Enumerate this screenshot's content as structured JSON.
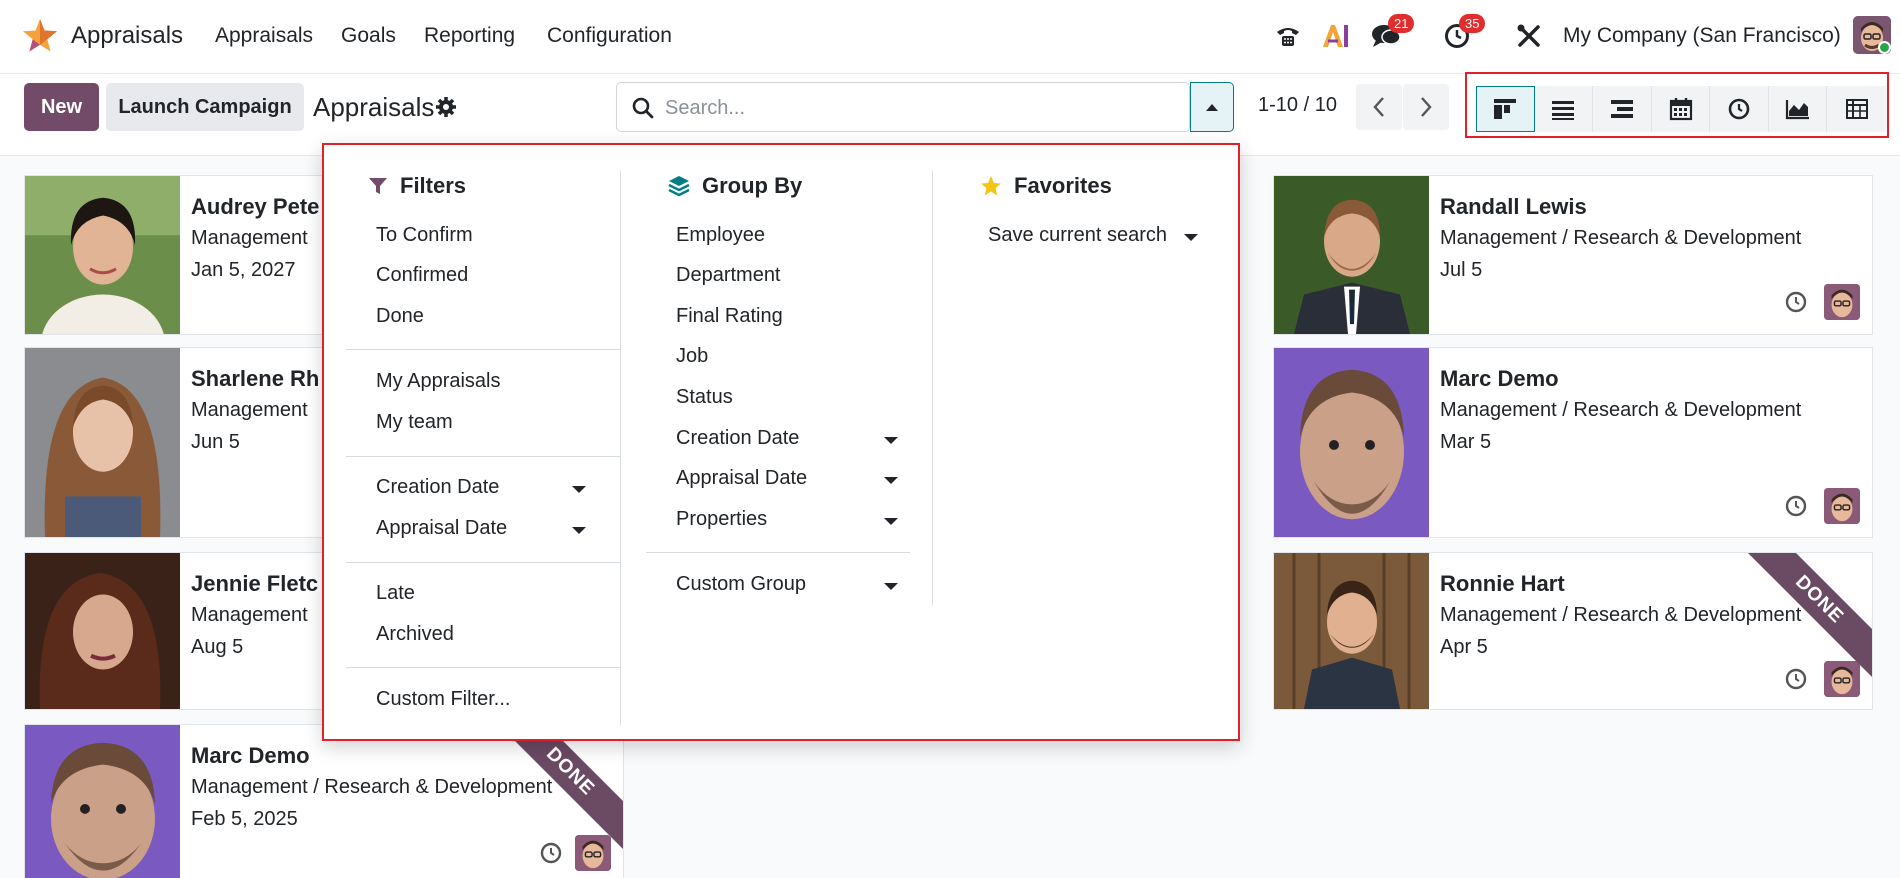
{
  "app": {
    "name": "Appraisals"
  },
  "nav": {
    "items": [
      "Appraisals",
      "Goals",
      "Reporting",
      "Configuration"
    ]
  },
  "systray": {
    "messages_count": "21",
    "activities_count": "35",
    "company": "My Company (San Francisco)"
  },
  "control": {
    "new_label": "New",
    "launch_label": "Launch Campaign",
    "title": "Appraisals",
    "search_placeholder": "Search...",
    "pager": "1-10 / 10"
  },
  "views": [
    "kanban",
    "list",
    "hierarchy",
    "calendar",
    "activity",
    "graph",
    "pivot"
  ],
  "cards": [
    {
      "name": "Audrey Pete",
      "dept": "Management",
      "date": "Jan 5, 2027",
      "ribbon": ""
    },
    {
      "name": "Sharlene Rh",
      "dept": "Management",
      "date": "Jun 5",
      "ribbon": ""
    },
    {
      "name": "Jennie Fletc",
      "dept": "Management",
      "date": "Aug 5",
      "ribbon": ""
    },
    {
      "name": "Marc Demo",
      "dept": "Management / Research & Development",
      "date": "Feb 5, 2025",
      "ribbon": "DONE"
    },
    {
      "name": "Randall Lewis",
      "dept": "Management / Research & Development",
      "date": "Jul 5",
      "ribbon": ""
    },
    {
      "name": "Marc Demo",
      "dept": "Management / Research & Development",
      "date": "Mar 5",
      "ribbon": ""
    },
    {
      "name": "Ronnie Hart",
      "dept": "Management / Research & Development",
      "date": "Apr 5",
      "ribbon": "DONE"
    }
  ],
  "filters": {
    "title": "Filters",
    "items": [
      "To Confirm",
      "Confirmed",
      "Done",
      "My Appraisals",
      "My team",
      "Creation Date",
      "Appraisal Date",
      "Late",
      "Archived",
      "Custom Filter..."
    ]
  },
  "groupby": {
    "title": "Group By",
    "items": [
      "Employee",
      "Department",
      "Final Rating",
      "Job",
      "Status",
      "Creation Date",
      "Appraisal Date",
      "Properties",
      "Custom Group"
    ]
  },
  "favorites": {
    "title": "Favorites",
    "items": [
      "Save current search"
    ]
  },
  "colors": {
    "brand": "#714b67",
    "accent": "#017e84",
    "highlight": "#e0202a"
  }
}
